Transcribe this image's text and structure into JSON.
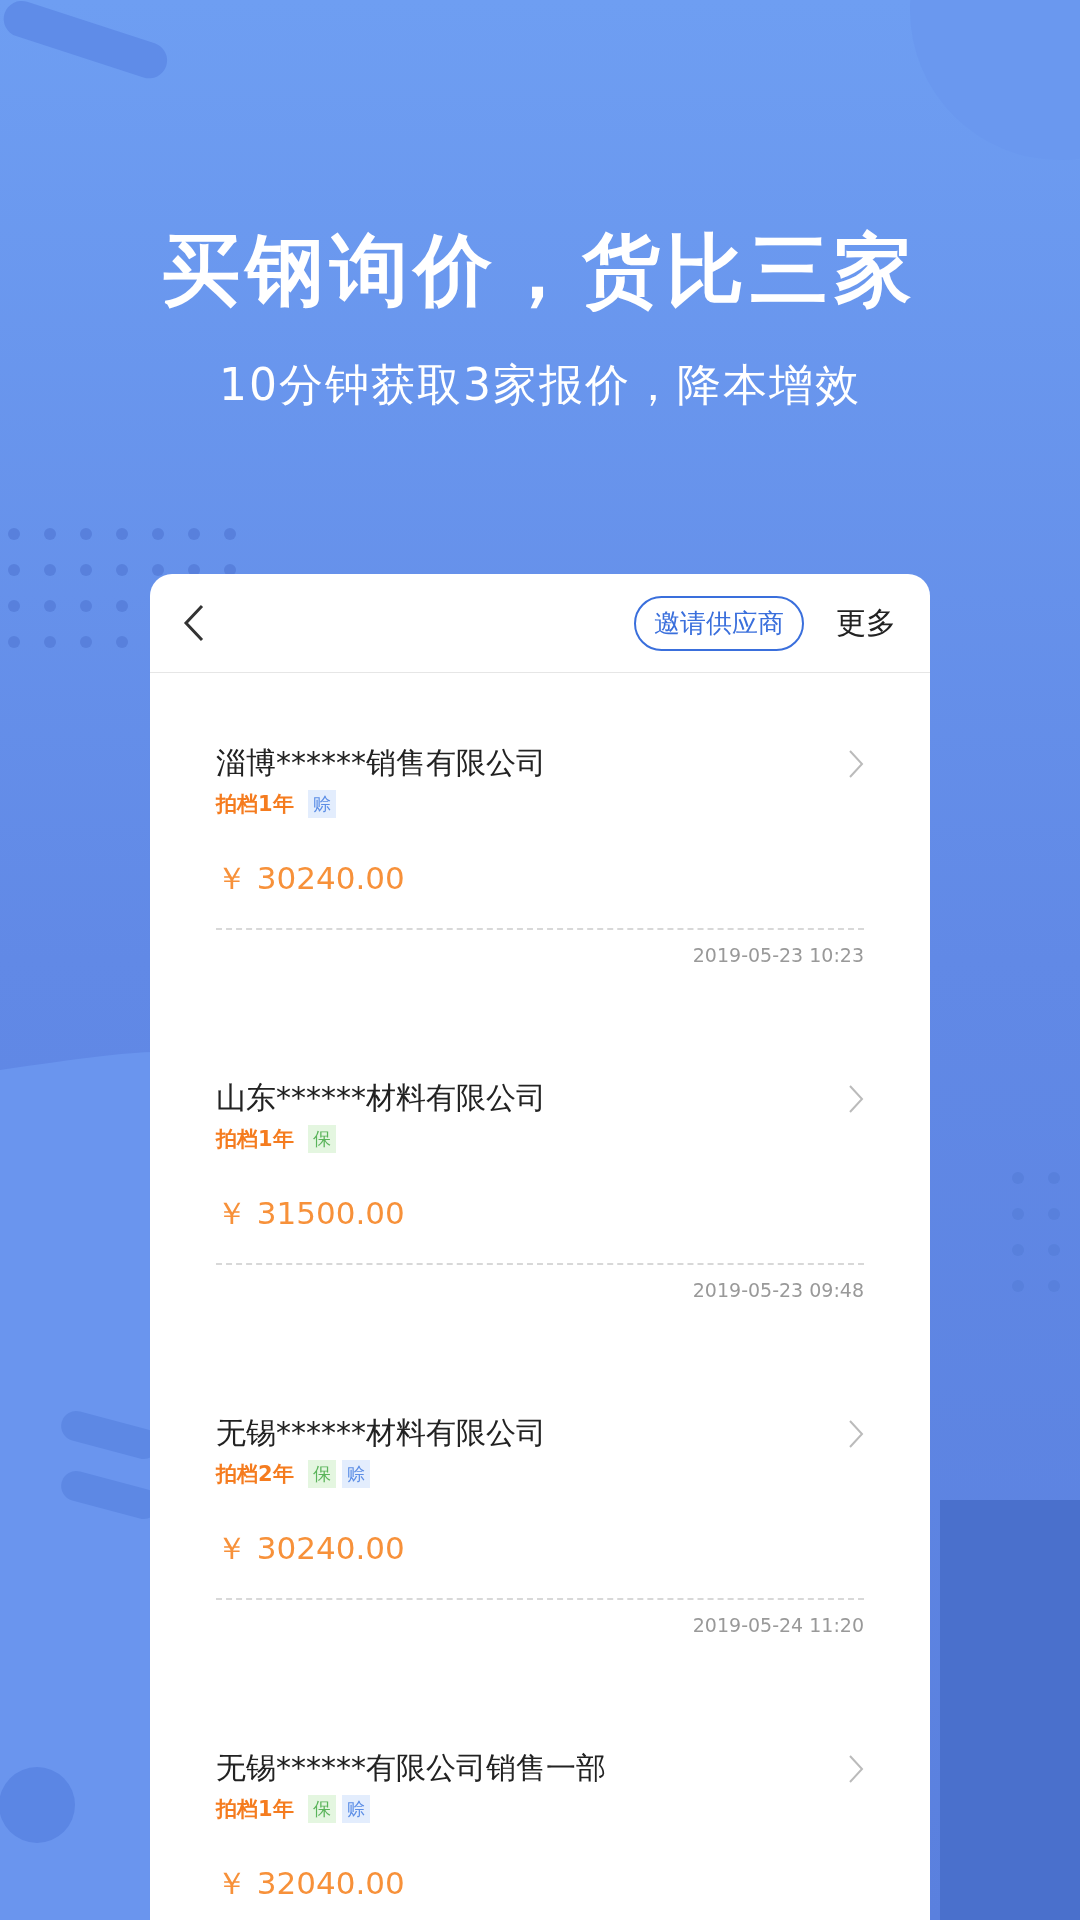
{
  "headline": "买钢询价，货比三家",
  "subheadline": "10分钟获取3家报价，降本增效",
  "nav": {
    "invite_button": "邀请供应商",
    "more": "更多"
  },
  "quotes": [
    {
      "company": "淄博******销售有限公司",
      "partner_years": "拍档1年",
      "tags": [
        {
          "kind": "compensation",
          "label": "赊"
        }
      ],
      "price": "￥ 30240.00",
      "time": "2019-05-23 10:23"
    },
    {
      "company": "山东******材料有限公司",
      "partner_years": "拍档1年",
      "tags": [
        {
          "kind": "guarantee",
          "label": "保"
        }
      ],
      "price": "￥ 31500.00",
      "time": "2019-05-23 09:48"
    },
    {
      "company": "无锡******材料有限公司",
      "partner_years": "拍档2年",
      "tags": [
        {
          "kind": "guarantee",
          "label": "保"
        },
        {
          "kind": "compensation",
          "label": "赊"
        }
      ],
      "price": "￥ 30240.00",
      "time": "2019-05-24 11:20"
    },
    {
      "company": "无锡******有限公司销售一部",
      "partner_years": "拍档1年",
      "tags": [
        {
          "kind": "guarantee",
          "label": "保"
        },
        {
          "kind": "compensation",
          "label": "赊"
        }
      ],
      "price": "￥ 32040.00"
    }
  ]
}
